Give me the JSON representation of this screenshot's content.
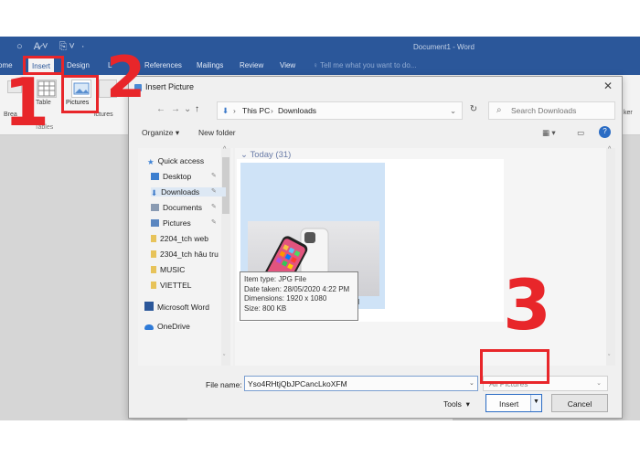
{
  "word": {
    "title": "Document1 - Word",
    "tabs": [
      "ome",
      "Insert",
      "Design",
      "L",
      "References",
      "Mailings",
      "Review",
      "View"
    ],
    "tell_me": "Tell me what you want to do...",
    "ribbon": {
      "table_label": "Table",
      "tables_group": "Tables",
      "pictures_label": "Pictures",
      "online_label": "ictures",
      "bre_label": "Brea",
      "ker_label": "ker"
    }
  },
  "dialog": {
    "title": "Insert Picture",
    "close_icon": "close-icon",
    "path": [
      "This PC",
      "Downloads"
    ],
    "search_placeholder": "Search Downloads",
    "organize_label": "Organize",
    "new_folder_label": "New folder",
    "nav_items": [
      {
        "label": "Quick access",
        "icon": "star-icon",
        "color": "#3f83d6"
      },
      {
        "label": "Desktop",
        "icon": "desktop-icon",
        "color": "#3d7fcf"
      },
      {
        "label": "Downloads",
        "icon": "download-icon",
        "color": "#3a78c8"
      },
      {
        "label": "Documents",
        "icon": "documents-icon",
        "color": "#8a9bb2"
      },
      {
        "label": "Pictures",
        "icon": "pictures-icon",
        "color": "#5a86c0"
      },
      {
        "label": "2204_tch web",
        "icon": "folder-icon",
        "color": "#e7c35a"
      },
      {
        "label": "2304_tch hâu tru",
        "icon": "folder-icon",
        "color": "#e7c35a"
      },
      {
        "label": "MUSIC",
        "icon": "folder-icon",
        "color": "#e7c35a"
      },
      {
        "label": "VIETTEL",
        "icon": "folder-icon",
        "color": "#e7c35a"
      },
      {
        "label": "Microsoft Word",
        "icon": "word-icon",
        "color": "#2b579a"
      },
      {
        "label": "OneDrive",
        "icon": "cloud-icon",
        "color": "#2f7bd8"
      }
    ],
    "group_header": "Today (31)",
    "file": {
      "name": "Yso4RHtjQbJPCancLkoXFM",
      "tooltip": [
        "Item type: JPG File",
        "Date taken: 28/05/2020 4:22 PM",
        "Dimensions: 1920 x 1080",
        "Size: 800 KB"
      ]
    },
    "file_name_label": "File name:",
    "file_name_value": "Yso4RHtjQbJPCancLkoXFM",
    "file_type": "All Pictures",
    "tools_label": "Tools",
    "insert_label": "Insert",
    "cancel_label": "Cancel"
  },
  "annotations": [
    "1",
    "2",
    "3"
  ],
  "colors": {
    "word_blue": "#2b579a",
    "annotation_red": "#e8262a",
    "selection": "#cfe3f7"
  }
}
